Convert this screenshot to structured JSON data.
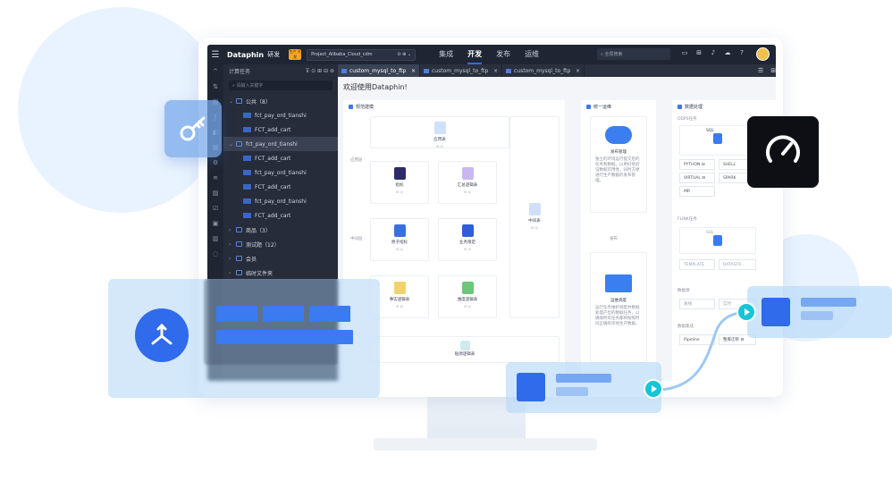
{
  "app": {
    "brand": "Dataphin",
    "brand_sub": "研发",
    "project_badge": "生产 开发",
    "project_name": "Project_Alibaba_Cloud_cdm",
    "project_suffix": "⊙ ⊕ ⌄",
    "nav": [
      "集成",
      "开发",
      "发布",
      "运维"
    ],
    "nav_active": "开发",
    "search_placeholder": "全局搜索",
    "header_icons": [
      "screen-icon",
      "grid-icon",
      "bell-icon",
      "cloud-icon",
      "help-icon"
    ]
  },
  "sidebar": {
    "title": "计算任务",
    "header_icons": "⊽ ⊙ ⊞ ⊟ ⊚",
    "search_placeholder": "请输入关键字",
    "tree": [
      {
        "label": "公共（8）",
        "kind": "folder",
        "indent": 0,
        "toggle": "⌄"
      },
      {
        "label": "fct_pay_ord_tianshi",
        "kind": "task",
        "indent": 1
      },
      {
        "label": "FCT_add_cart",
        "kind": "task",
        "indent": 1
      },
      {
        "label": "fct_pay_ord_tianshi",
        "kind": "folder",
        "indent": 0,
        "toggle": "⌄",
        "selected": true
      },
      {
        "label": "FCT_add_cart",
        "kind": "task",
        "indent": 1
      },
      {
        "label": "fct_pay_ord_tianshi",
        "kind": "task",
        "indent": 1
      },
      {
        "label": "FCT_add_cart",
        "kind": "task",
        "indent": 1
      },
      {
        "label": "fct_pay_ord_tianshi",
        "kind": "task",
        "indent": 1
      },
      {
        "label": "FCT_add_cart",
        "kind": "task",
        "indent": 1
      },
      {
        "label": "商品（3）",
        "kind": "folder",
        "indent": 0,
        "toggle": "›"
      },
      {
        "label": "测试题（12）",
        "kind": "folder",
        "indent": 0,
        "toggle": "›"
      },
      {
        "label": "会员",
        "kind": "folder",
        "indent": 0,
        "toggle": "›"
      },
      {
        "label": "临时文件夹",
        "kind": "folder",
        "indent": 0,
        "toggle": "›"
      }
    ]
  },
  "tabs": [
    {
      "label": "custom_mysql_to_ftp",
      "close": "×",
      "active": true
    },
    {
      "label": "custom_mysql_to_ftp",
      "close": "×",
      "active": false
    },
    {
      "label": "custom_mysql_to_ftp",
      "close": "×",
      "active": false
    }
  ],
  "tabs_right": [
    "☰",
    "⊞"
  ],
  "main": {
    "welcome": "欢迎使用Dataphin!",
    "section_modeling": "规范建模",
    "section_release": "统一运维",
    "section_process": "数据处理",
    "row_app": "应用层",
    "row_mid": "中间层",
    "row_app_mark": "—",
    "row_mid_mark": "—",
    "card_app_table": "应用表",
    "card_metric": "指标",
    "card_summary_logic": "汇总逻辑表",
    "card_atomic_metric": "原子指标",
    "card_business_limit": "业务限定",
    "card_fact_logic": "事实逻辑表",
    "card_dim_logic": "维度逻辑表",
    "card_mid_table": "中间表",
    "card_source_logic": "贴源逻辑表",
    "card_icons_small": "⊟ ◎",
    "release_title": "发布管理",
    "release_desc": "独立的环境运行提交后的任务和数据，以更好地验证数据可用性，同时方便进行生产数据的发布管理。",
    "ops_title": "运维调度",
    "ops_desc": "运行任务维护调度并数据处理产出的数据任务，以确保所有任务都将按照时间正确有序地生产数据。",
    "ops_tag": "发布",
    "odps_label": "ODPS任务",
    "sql": "SQL",
    "python": "PYTHON",
    "shell": "SHELL",
    "virtual": "VIRTUAL",
    "mr": "MR",
    "spark": "SPARK",
    "flink_label": "FLINK任务",
    "template": "TEMPLATE",
    "datastream": "DATASTR...",
    "datasrc_label": "数据源",
    "offline": "离线",
    "realtime": "实时",
    "integration_label": "数据集成",
    "pipeline": "Pipeline",
    "whole_db": "整库迁移",
    "chip_icon": "⊟"
  },
  "colors": {
    "accent": "#2f6bea",
    "topbar": "#1f2532",
    "sidebar": "#262c39",
    "cyan": "#16c5d6"
  }
}
